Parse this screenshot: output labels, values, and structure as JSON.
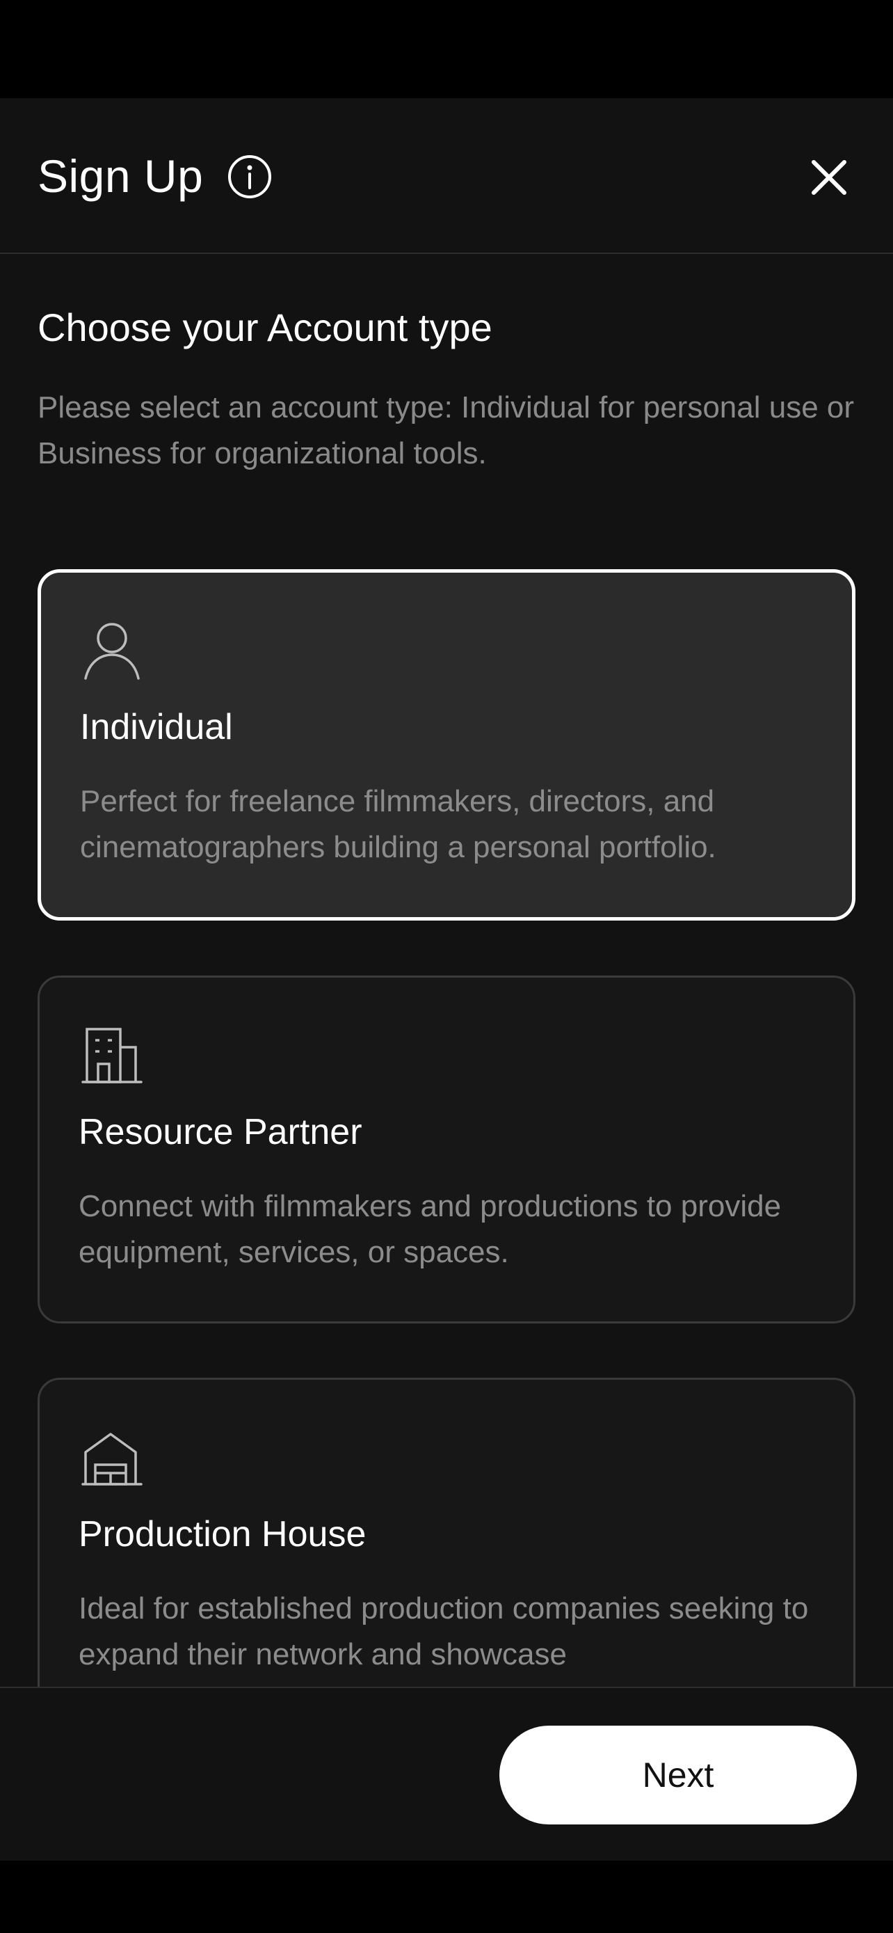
{
  "header": {
    "title": "Sign Up",
    "info_icon": "info-circle-icon",
    "close_icon": "close-icon"
  },
  "section": {
    "heading": "Choose your Account type",
    "description": "Please select an account type: Individual for personal use or Business for organizational tools."
  },
  "account_types": [
    {
      "title": "Individual",
      "description": "Perfect for freelance filmmakers, directors, and cinematographers building a personal portfolio.",
      "icon": "user-icon",
      "selected": true
    },
    {
      "title": "Resource Partner",
      "description": "Connect with filmmakers and productions to provide equipment, services, or spaces.",
      "icon": "building-icon",
      "selected": false
    },
    {
      "title": "Production House",
      "description": "Ideal for established production companies seeking to expand their network and showcase",
      "icon": "warehouse-icon",
      "selected": false
    }
  ],
  "footer": {
    "next_label": "Next"
  },
  "colors": {
    "background": "#121212",
    "selected_card": "#2b2b2b",
    "card": "#171717",
    "accent": "#ffffff",
    "muted_text": "#8a8a8a"
  }
}
